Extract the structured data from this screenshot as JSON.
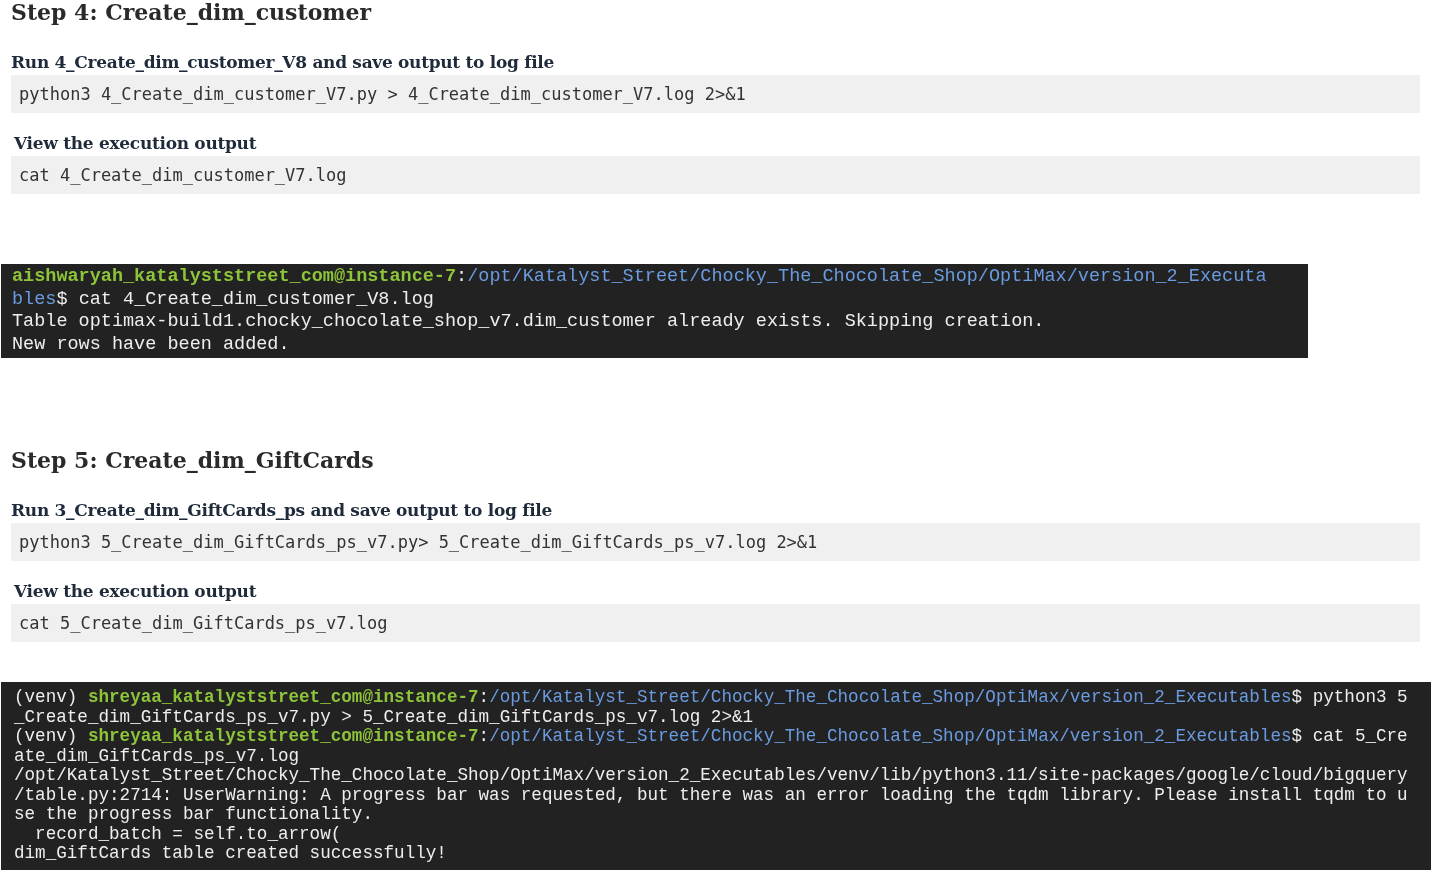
{
  "blocks": [
    {
      "kind": "heading",
      "text": "Step 4: Create_dim_customer"
    },
    {
      "kind": "subheading",
      "text": "Run 4_Create_dim_customer_V8 and save output to log file"
    },
    {
      "kind": "code",
      "text": "python3 4_Create_dim_customer_V7.py > 4_Create_dim_customer_V7.log 2>&1"
    },
    {
      "kind": "subheading",
      "text": "View the execution output"
    },
    {
      "kind": "code",
      "text": "cat 4_Create_dim_customer_V7.log"
    },
    {
      "kind": "terminal",
      "lines": [
        [
          {
            "kind": "user",
            "text": "aishwaryah_katalyststreet_com@instance-7"
          },
          {
            "kind": "plain",
            "text": ":"
          },
          {
            "kind": "path",
            "text": "/opt/Katalyst_Street/Chocky_The_Chocolate_Shop/OptiMax/version_2_Executa"
          }
        ],
        [
          {
            "kind": "path",
            "text": "bles"
          },
          {
            "kind": "plain",
            "text": "$ cat 4_Create_dim_customer_V8.log"
          }
        ],
        [
          {
            "kind": "plain",
            "text": "Table optimax-build1.chocky_chocolate_shop_v7.dim_customer already exists. Skipping creation."
          }
        ],
        [
          {
            "kind": "plain",
            "text": "New rows have been added."
          }
        ]
      ]
    },
    {
      "kind": "heading",
      "text": "Step 5: Create_dim_GiftCards"
    },
    {
      "kind": "subheading",
      "text": "Run 3_Create_dim_GiftCards_ps and save output to log file"
    },
    {
      "kind": "code",
      "text": "python3 5_Create_dim_GiftCards_ps_v7.py> 5_Create_dim_GiftCards_ps_v7.log 2>&1"
    },
    {
      "kind": "subheading",
      "text": "View the execution output"
    },
    {
      "kind": "code",
      "text": "cat 5_Create_dim_GiftCards_ps_v7.log"
    },
    {
      "kind": "terminal",
      "lines": [
        [
          {
            "kind": "plain",
            "text": "(venv) "
          },
          {
            "kind": "user",
            "text": "shreyaa_katalyststreet_com@instance-7"
          },
          {
            "kind": "plain",
            "text": ":"
          },
          {
            "kind": "path",
            "text": "/opt/Katalyst_Street/Chocky_The_Chocolate_Shop/OptiMax/version_2_Executables"
          },
          {
            "kind": "plain",
            "text": "$ python3 5"
          }
        ],
        [
          {
            "kind": "plain",
            "text": "_Create_dim_GiftCards_ps_v7.py > 5_Create_dim_GiftCards_ps_v7.log 2>&1"
          }
        ],
        [
          {
            "kind": "plain",
            "text": "(venv) "
          },
          {
            "kind": "user",
            "text": "shreyaa_katalyststreet_com@instance-7"
          },
          {
            "kind": "plain",
            "text": ":"
          },
          {
            "kind": "path",
            "text": "/opt/Katalyst_Street/Chocky_The_Chocolate_Shop/OptiMax/version_2_Executables"
          },
          {
            "kind": "plain",
            "text": "$ cat 5_Cre"
          }
        ],
        [
          {
            "kind": "plain",
            "text": "ate_dim_GiftCards_ps_v7.log"
          }
        ],
        [
          {
            "kind": "plain",
            "text": "/opt/Katalyst_Street/Chocky_The_Chocolate_Shop/OptiMax/version_2_Executables/venv/lib/python3.11/site-packages/google/cloud/bigquery"
          }
        ],
        [
          {
            "kind": "plain",
            "text": "/table.py:2714: UserWarning: A progress bar was requested, but there was an error loading the tqdm library. Please install tqdm to u"
          }
        ],
        [
          {
            "kind": "plain",
            "text": "se the progress bar functionality."
          }
        ],
        [
          {
            "kind": "plain",
            "text": "  record_batch = self.to_arrow("
          }
        ],
        [
          {
            "kind": "plain",
            "text": "dim_GiftCards table created successfully!"
          }
        ]
      ]
    }
  ]
}
